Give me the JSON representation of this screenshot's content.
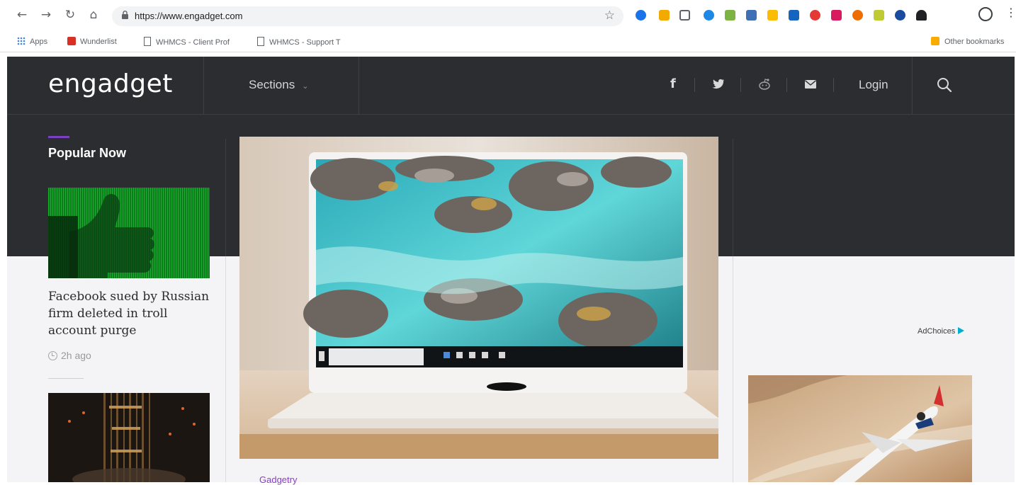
{
  "browser": {
    "url": "https://www.engadget.com",
    "bookmarks": [
      {
        "label": "Apps"
      },
      {
        "label": "Wunderlist"
      },
      {
        "label": "WHMCS - Client Prof"
      },
      {
        "label": "WHMCS - Support T"
      }
    ],
    "other_bookmarks": "Other bookmarks"
  },
  "site": {
    "logo": "engadget",
    "nav": {
      "sections_label": "Sections",
      "login_label": "Login"
    },
    "popular_now": {
      "heading": "Popular Now",
      "stories": [
        {
          "title": "Facebook sued by Russian firm deleted in troll account purge",
          "time": "2h ago"
        }
      ]
    },
    "hero": {
      "category": "Gadgetry"
    },
    "ad": {
      "adchoices_label": "AdChoices"
    }
  },
  "colors": {
    "header_bg": "#2b2d30",
    "accent_purple": "#7a3fc3",
    "page_bg": "#f4f4f6"
  }
}
